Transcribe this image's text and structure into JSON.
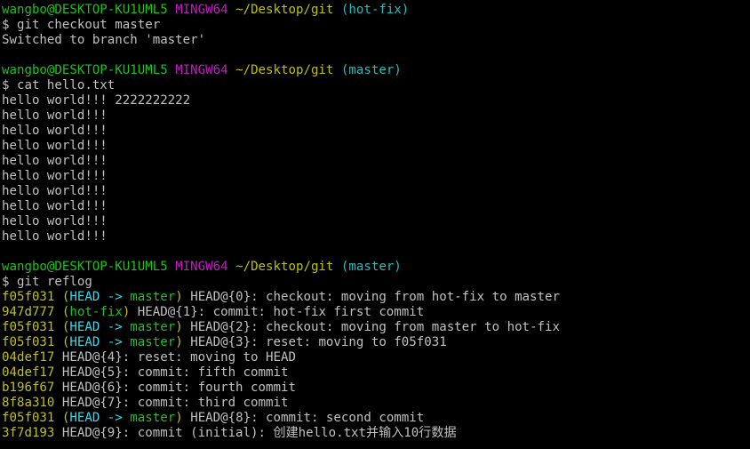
{
  "colors": {
    "background": "#000000",
    "text": "#c0c0c0",
    "user_host": "#1fbf1f",
    "mingw": "#bf1fbf",
    "path": "#c0c000",
    "branch": "#1fbfbf",
    "hash": "#bfbf1f"
  },
  "prompt1": {
    "user_host": "wangbo@DESKTOP-KU1UML5",
    "env": "MINGW64",
    "path": "~/Desktop/git",
    "branch": "(hot-fix)"
  },
  "cmd1": {
    "command": "$ git checkout master",
    "output": "Switched to branch 'master'"
  },
  "prompt2": {
    "user_host": "wangbo@DESKTOP-KU1UML5",
    "env": "MINGW64",
    "path": "~/Desktop/git",
    "branch": "(master)"
  },
  "cmd2": {
    "command": "$ cat hello.txt",
    "output_lines": [
      "hello world!!! 2222222222",
      "hello world!!!",
      "hello world!!!",
      "hello world!!!",
      "hello world!!!",
      "hello world!!!",
      "hello world!!!",
      "hello world!!!",
      "hello world!!!",
      "hello world!!!"
    ]
  },
  "prompt3": {
    "user_host": "wangbo@DESKTOP-KU1UML5",
    "env": "MINGW64",
    "path": "~/Desktop/git",
    "branch": "(master)"
  },
  "cmd3": {
    "command": "$ git reflog",
    "reflog": [
      {
        "hash": "f05f031",
        "ref_open": "(",
        "ref_head": "HEAD -> ",
        "ref_branch": "master",
        "ref_close": ")",
        "rest": " HEAD@{0}: checkout: moving from hot-fix to master"
      },
      {
        "hash": "947d777",
        "ref_open": "(",
        "ref_head": "",
        "ref_branch": "hot-fix",
        "ref_close": ")",
        "rest": " HEAD@{1}: commit: hot-fix first commit"
      },
      {
        "hash": "f05f031",
        "ref_open": "(",
        "ref_head": "HEAD -> ",
        "ref_branch": "master",
        "ref_close": ")",
        "rest": " HEAD@{2}: checkout: moving from master to hot-fix"
      },
      {
        "hash": "f05f031",
        "ref_open": "(",
        "ref_head": "HEAD -> ",
        "ref_branch": "master",
        "ref_close": ")",
        "rest": " HEAD@{3}: reset: moving to f05f031"
      },
      {
        "hash": "04def17",
        "ref_open": "",
        "ref_head": "",
        "ref_branch": "",
        "ref_close": "",
        "rest": " HEAD@{4}: reset: moving to HEAD"
      },
      {
        "hash": "04def17",
        "ref_open": "",
        "ref_head": "",
        "ref_branch": "",
        "ref_close": "",
        "rest": " HEAD@{5}: commit: fifth commit"
      },
      {
        "hash": "b196f67",
        "ref_open": "",
        "ref_head": "",
        "ref_branch": "",
        "ref_close": "",
        "rest": " HEAD@{6}: commit: fourth commit"
      },
      {
        "hash": "8f8a310",
        "ref_open": "",
        "ref_head": "",
        "ref_branch": "",
        "ref_close": "",
        "rest": " HEAD@{7}: commit: third commit"
      },
      {
        "hash": "f05f031",
        "ref_open": "(",
        "ref_head": "HEAD -> ",
        "ref_branch": "master",
        "ref_close": ")",
        "rest": " HEAD@{8}: commit: second commit"
      },
      {
        "hash": "3f7d193",
        "ref_open": "",
        "ref_head": "",
        "ref_branch": "",
        "ref_close": "",
        "rest": " HEAD@{9}: commit (initial): 创建hello.txt并输入10行数据"
      }
    ]
  }
}
